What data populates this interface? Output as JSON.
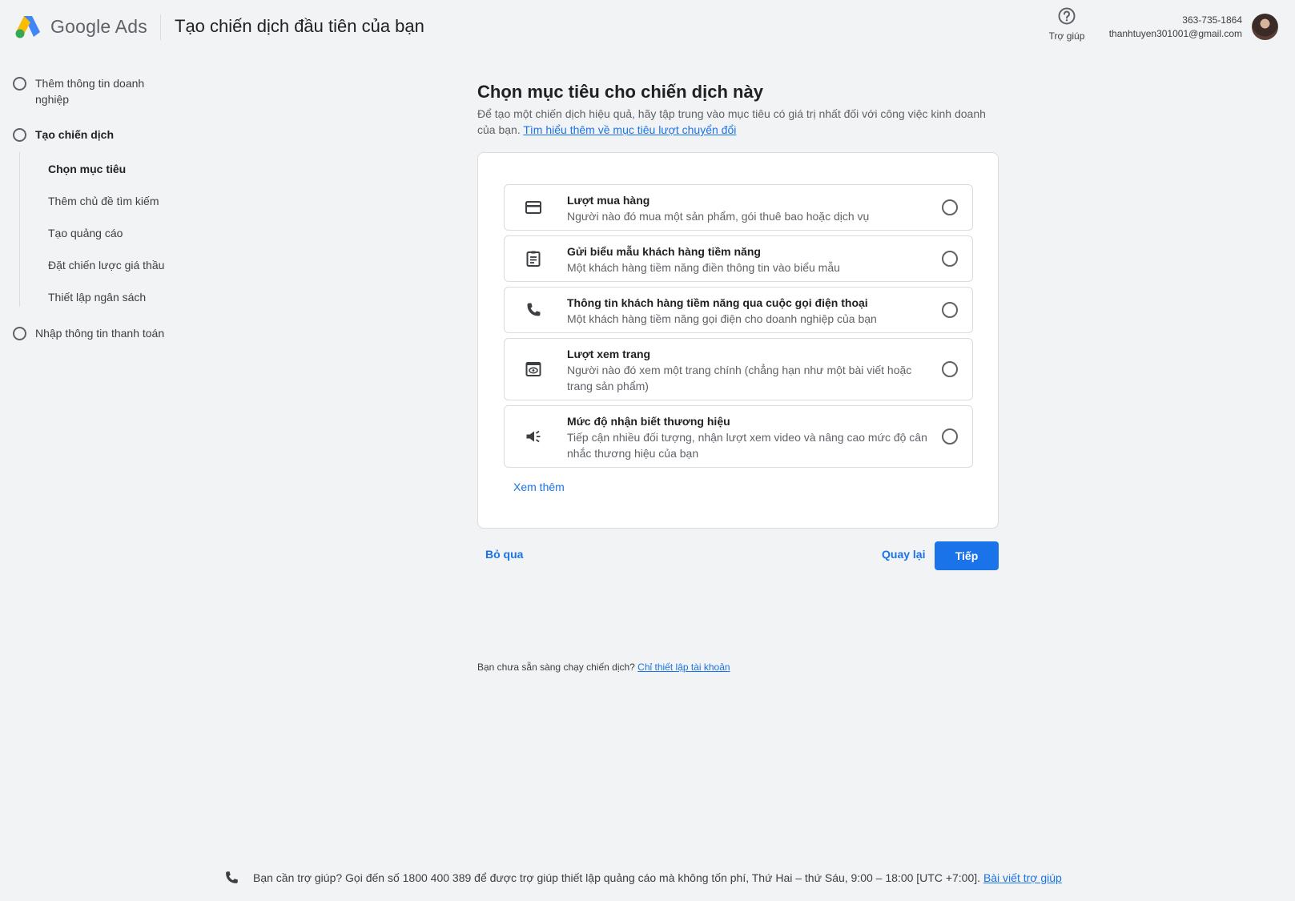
{
  "header": {
    "brand": "Google Ads",
    "page_title": "Tạo chiến dịch đầu tiên của bạn",
    "help_label": "Trợ giúp",
    "account_phone": "363-735-1864",
    "account_email": "thanhtuyen301001@gmail.com"
  },
  "sidebar": {
    "steps": [
      {
        "label": "Thêm thông tin doanh nghiệp"
      },
      {
        "label": "Tạo chiến dịch"
      },
      {
        "label": "Nhập thông tin thanh toán"
      }
    ],
    "substeps": [
      {
        "label": "Chọn mục tiêu"
      },
      {
        "label": "Thêm chủ đề tìm kiếm"
      },
      {
        "label": "Tạo quảng cáo"
      },
      {
        "label": "Đặt chiến lược giá thầu"
      },
      {
        "label": "Thiết lập ngân sách"
      }
    ]
  },
  "main": {
    "title": "Chọn mục tiêu cho chiến dịch này",
    "description": "Để tạo một chiến dịch hiệu quả, hãy tập trung vào mục tiêu có giá trị nhất đối với công việc kinh doanh của bạn.",
    "learn_more_link": "Tìm hiểu thêm về mục tiêu lượt chuyển đổi",
    "options": [
      {
        "icon": "credit-card-icon",
        "title": "Lượt mua hàng",
        "description": "Người nào đó mua một sản phẩm, gói thuê bao hoặc dịch vụ"
      },
      {
        "icon": "clipboard-form-icon",
        "title": "Gửi biểu mẫu khách hàng tiềm năng",
        "description": "Một khách hàng tiềm năng điền thông tin vào biểu mẫu"
      },
      {
        "icon": "phone-icon",
        "title": "Thông tin khách hàng tiềm năng qua cuộc gọi điện thoại",
        "description": "Một khách hàng tiềm năng gọi điện cho doanh nghiệp của bạn"
      },
      {
        "icon": "page-view-icon",
        "title": "Lượt xem trang",
        "description": "Người nào đó xem một trang chính (chẳng hạn như một bài viết hoặc trang sản phẩm)"
      },
      {
        "icon": "megaphone-icon",
        "title": "Mức độ nhận biết thương hiệu",
        "description": "Tiếp cận nhiều đối tượng, nhận lượt xem video và nâng cao mức độ cân nhắc thương hiệu của bạn"
      }
    ],
    "see_more": "Xem thêm",
    "skip": "Bỏ qua",
    "back": "Quay lại",
    "next": "Tiếp"
  },
  "not_ready": {
    "text": "Bạn chưa sẵn sàng chạy chiến dịch?",
    "link": "Chỉ thiết lập tài khoản"
  },
  "footer": {
    "text": "Bạn cần trợ giúp? Gọi đến số 1800 400 389 để được trợ giúp thiết lập quảng cáo mà không tốn phí, Thứ Hai – thứ Sáu, 9:00 – 18:00 [UTC +7:00].",
    "link": "Bài viết trợ giúp"
  },
  "colors": {
    "accent": "#1a73e8",
    "background": "#f1f3f4"
  }
}
